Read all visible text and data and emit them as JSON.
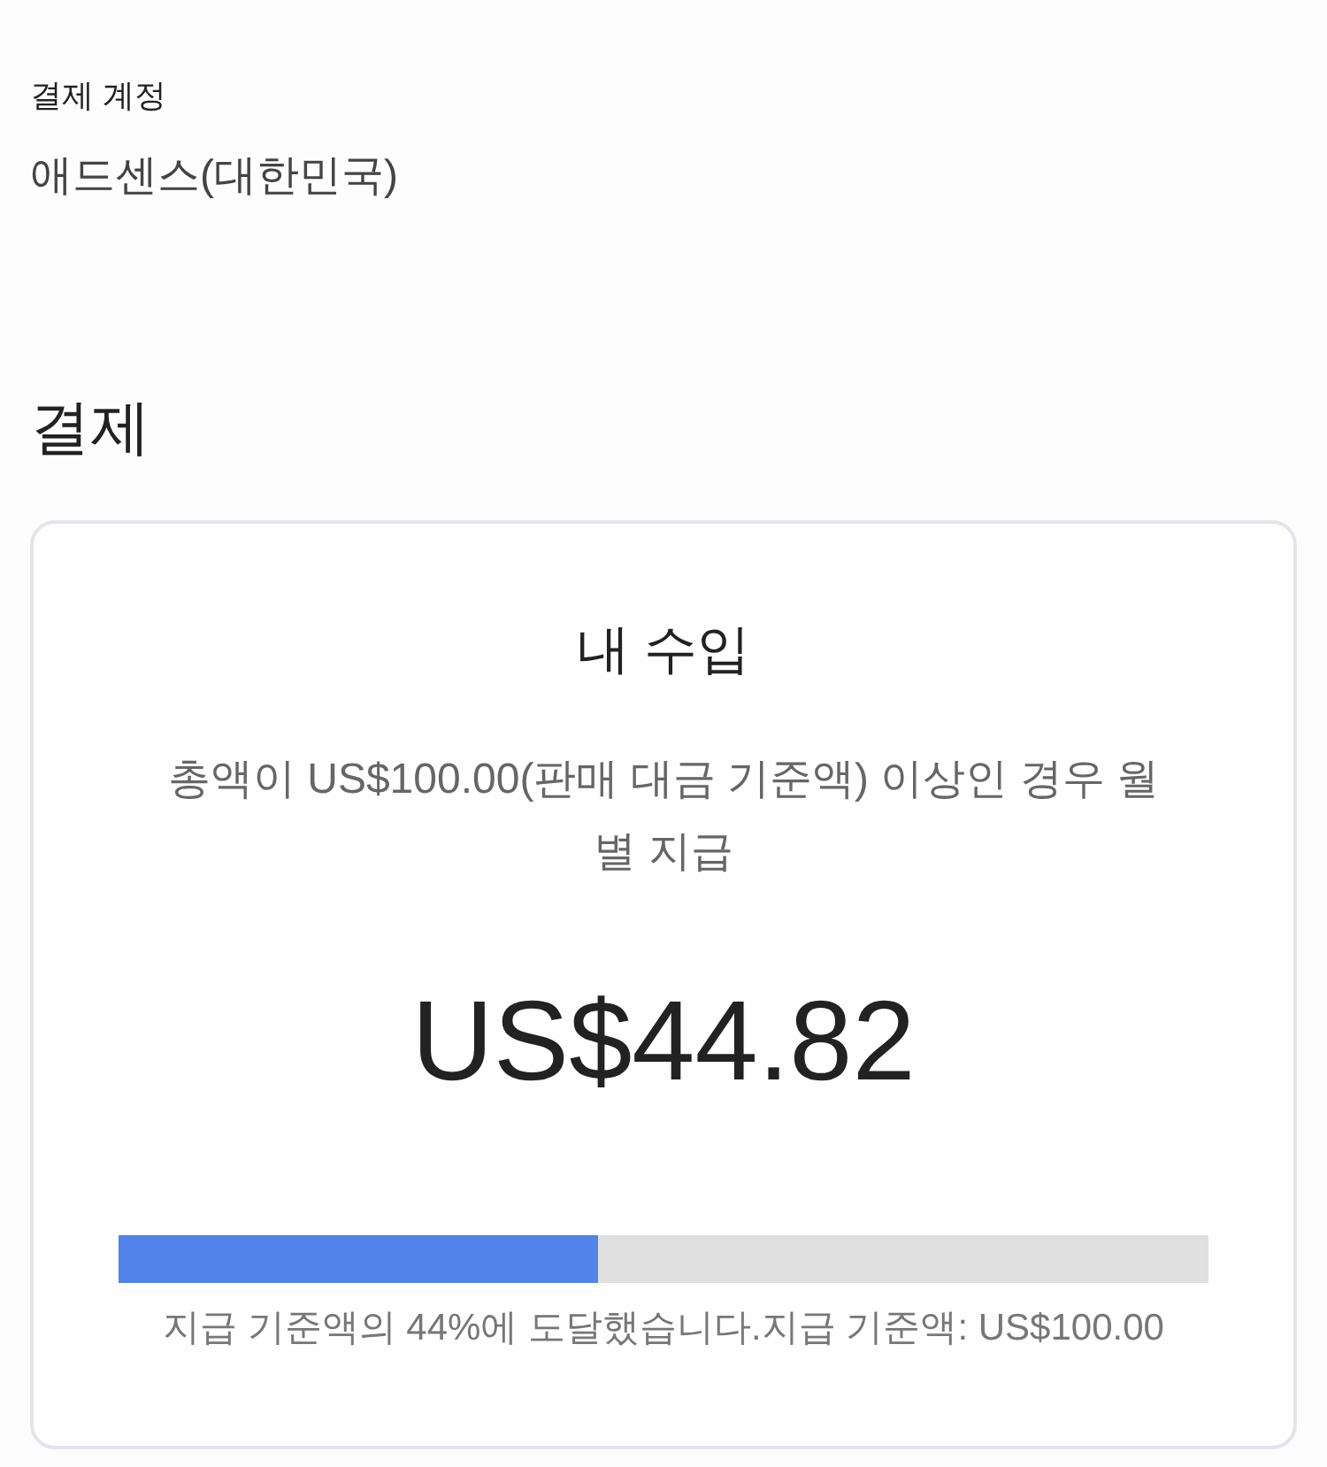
{
  "payment_account": {
    "label": "결제 계정",
    "value": "애드센스(대한민국)"
  },
  "section_title": "결제",
  "earnings_card": {
    "title": "내 수입",
    "description": "총액이 US$100.00(판매 대금 기준액) 이상인 경우 월별 지급",
    "amount": "US$44.82",
    "progress": {
      "level": 0.44
    },
    "caption": "지급 기준액의 44%에 도달했습니다.지급 기준액: US$100.00"
  }
}
